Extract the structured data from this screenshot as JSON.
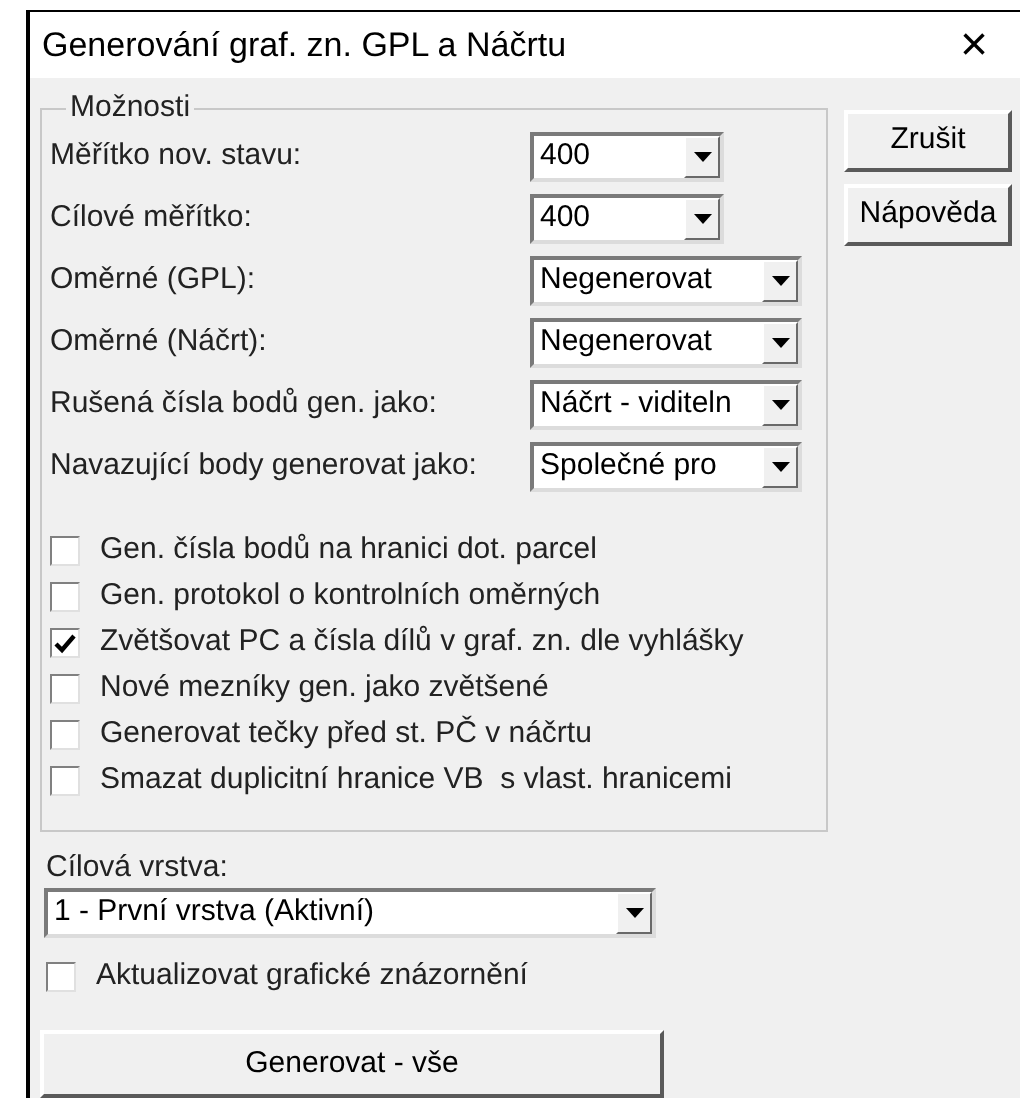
{
  "window": {
    "title": "Generování graf. zn. GPL a Náčrtu",
    "close": "×"
  },
  "options_group": {
    "legend": "Možnosti",
    "fields": [
      {
        "label": "Měřítko nov. stavu:",
        "value": "400",
        "wide": false
      },
      {
        "label": "Cílové měřítko:",
        "value": "400",
        "wide": false
      },
      {
        "label": "Oměrné (GPL):",
        "value": "Negenerovat",
        "wide": true
      },
      {
        "label": "Oměrné (Náčrt):",
        "value": "Negenerovat",
        "wide": true
      },
      {
        "label": "Rušená čísla bodů gen. jako:",
        "value": "Náčrt - viditeln",
        "wide": true
      },
      {
        "label": "Navazující body generovat jako:",
        "value": "Společné pro",
        "wide": true
      }
    ],
    "checkboxes": [
      {
        "label": "Gen. čísla bodů na hranici dot. parcel",
        "checked": false
      },
      {
        "label": "Gen. protokol o kontrolních oměrných",
        "checked": false
      },
      {
        "label": "Zvětšovat PC a čísla dílů v graf. zn. dle vyhlášky",
        "checked": true
      },
      {
        "label": "Nové mezníky gen. jako zvětšené",
        "checked": false
      },
      {
        "label": "Generovat tečky před st. PČ v náčrtu",
        "checked": false
      },
      {
        "label": "Smazat duplicitní hranice VB  s vlast. hranicemi",
        "checked": false
      }
    ]
  },
  "side_buttons": [
    "Zrušit",
    "Nápověda"
  ],
  "target_layer": {
    "label": "Cílová vrstva:",
    "value": "1 - První vrstva (Aktivní)"
  },
  "update_checkbox": {
    "label": "Aktualizovat grafické znázornění",
    "checked": false
  },
  "generate_button": "Generovat - vše"
}
